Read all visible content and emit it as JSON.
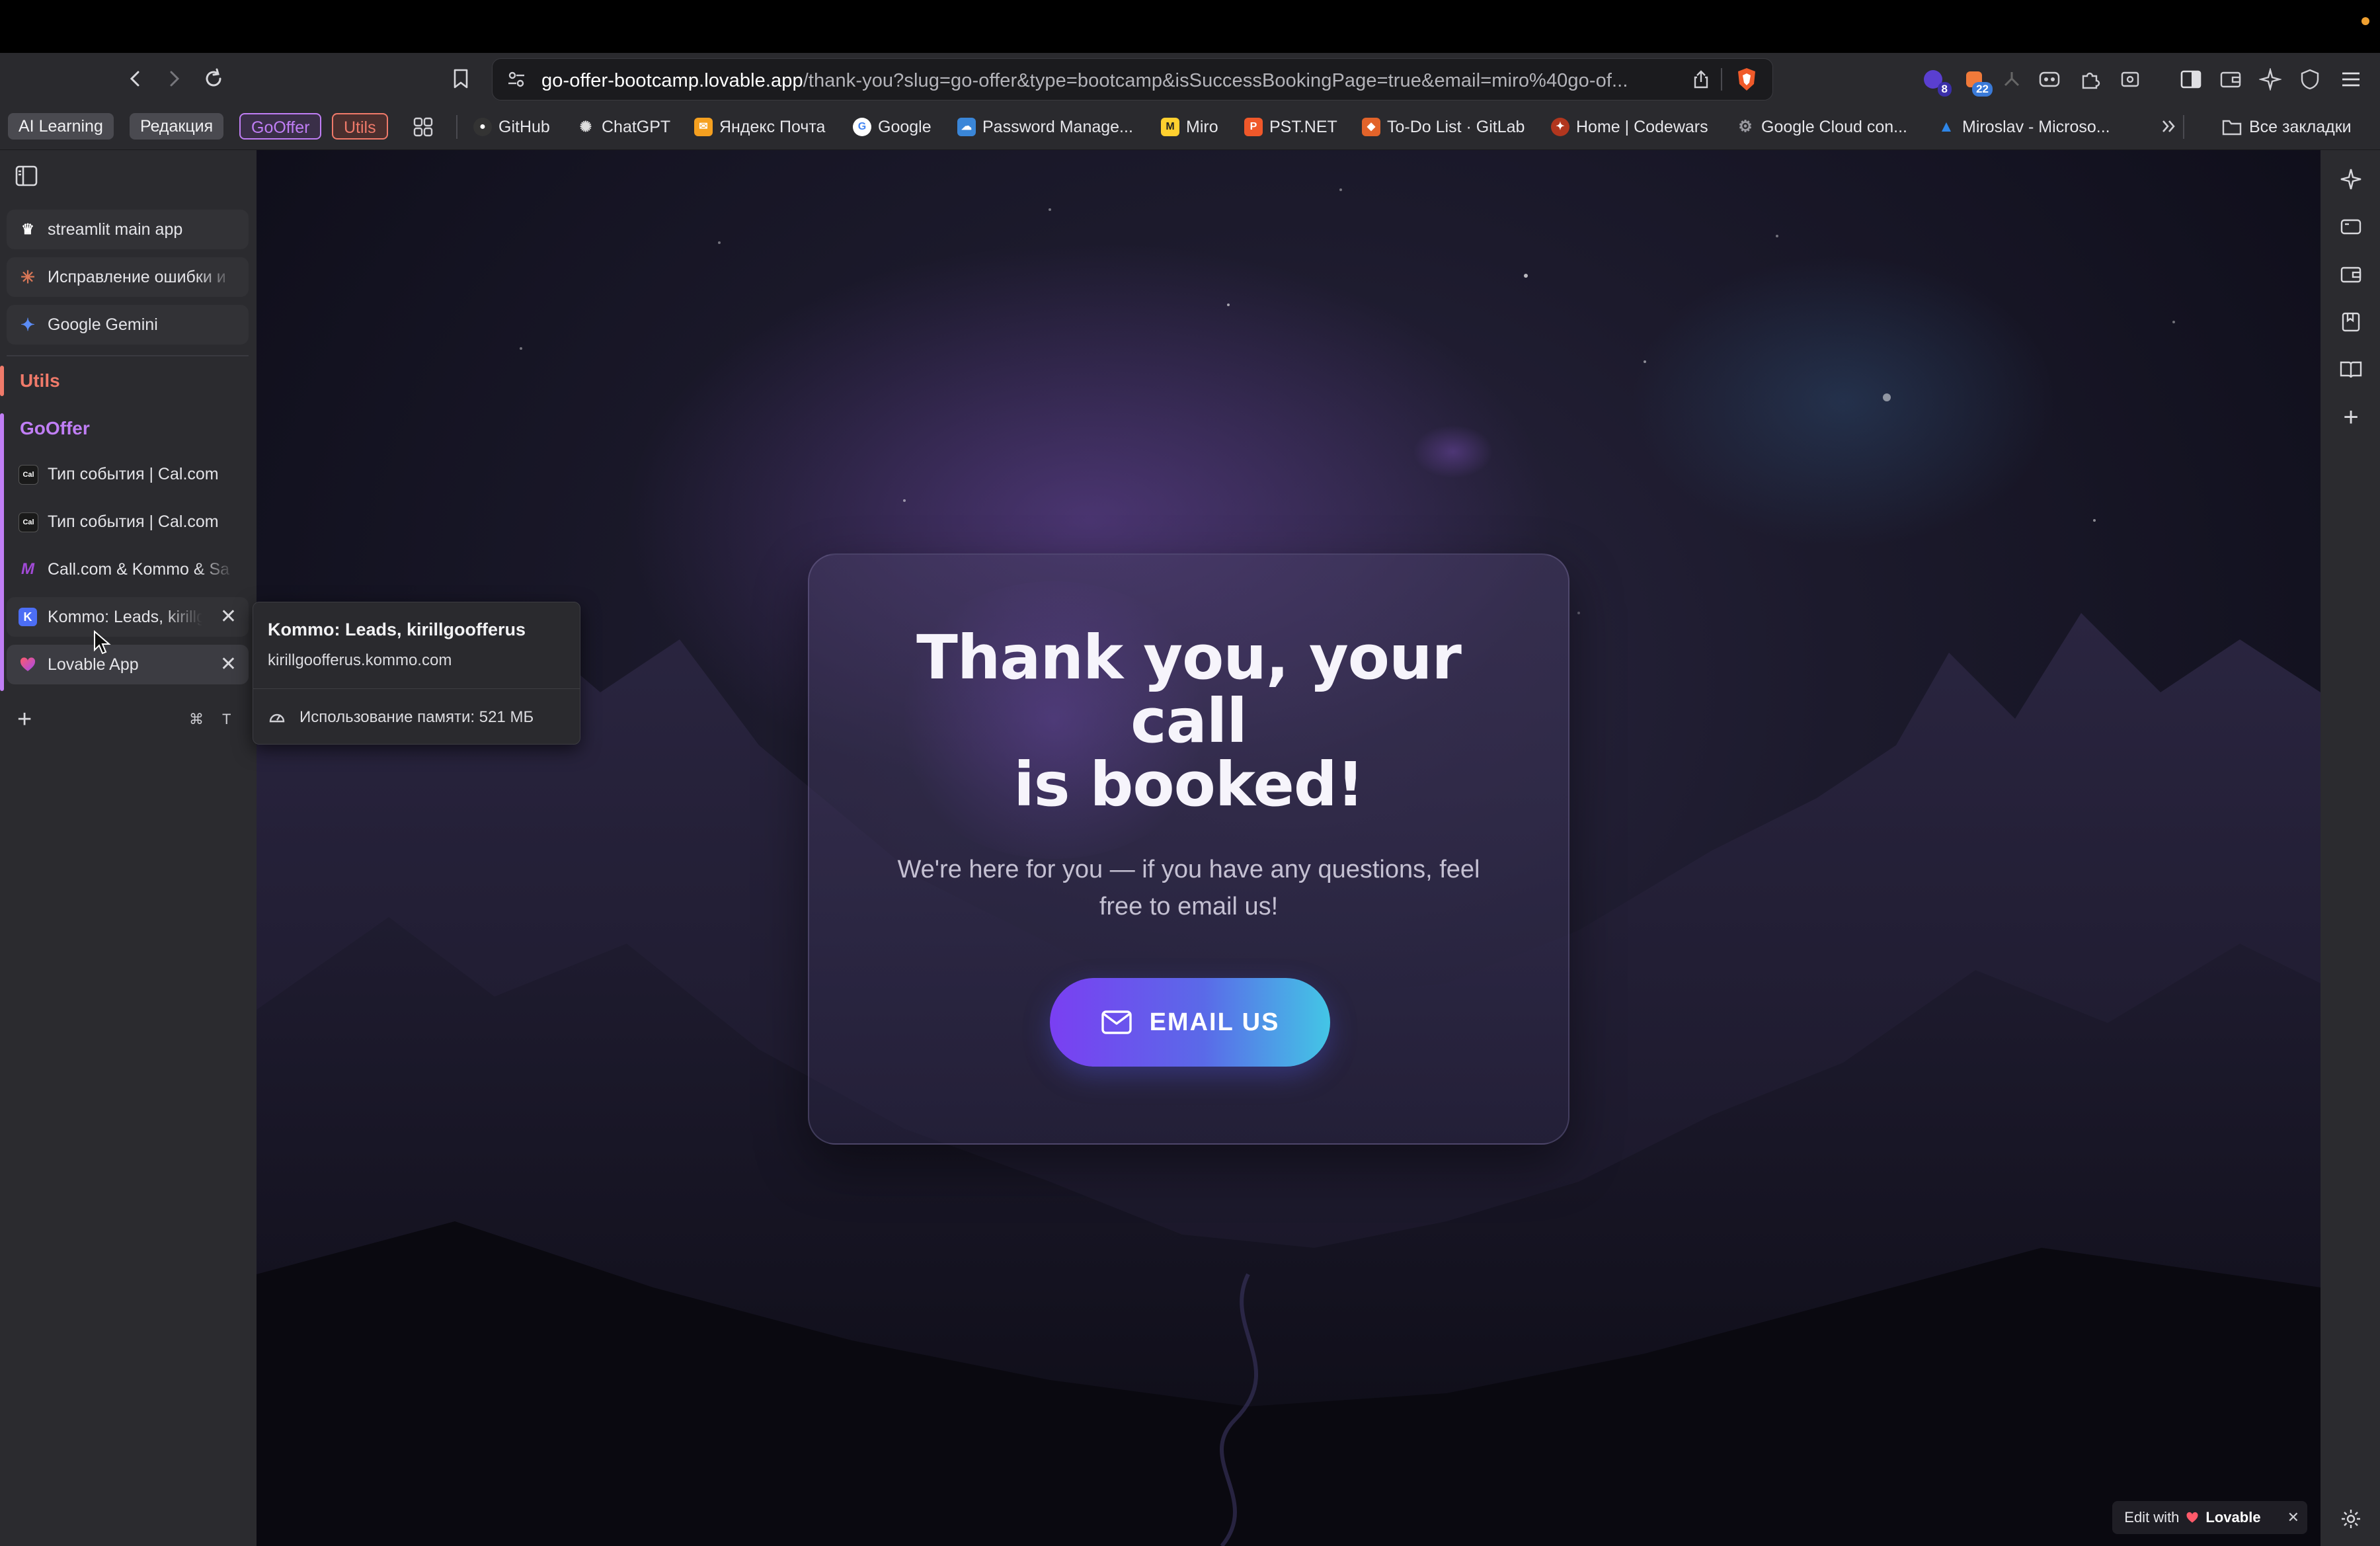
{
  "browser": {
    "url_host": "go-offer-bootcamp.lovable.app",
    "url_path": "/thank-you?slug=go-offer&type=bootcamp&isSuccessBookingPage=true&email=miro%40go-of...",
    "extension_badges": [
      "8",
      "22"
    ]
  },
  "bookmarks_bar": {
    "tab_groups": [
      {
        "label": "AI Learning",
        "color": "#4a4a50"
      },
      {
        "label": "Редакция",
        "color": "#4a4a50"
      },
      {
        "label": "GoOffer",
        "color": "#c07ef5"
      },
      {
        "label": "Utils",
        "color": "#f07a6a"
      }
    ],
    "items": [
      {
        "label": "GitHub",
        "icon": "github-icon"
      },
      {
        "label": "ChatGPT",
        "icon": "chatgpt-icon"
      },
      {
        "label": "Яндекс Почта",
        "icon": "mail-icon"
      },
      {
        "label": "Google",
        "icon": "google-icon"
      },
      {
        "label": "Password Manage...",
        "icon": "cloud-icon"
      },
      {
        "label": "Miro",
        "icon": "miro-icon"
      },
      {
        "label": "PST.NET",
        "icon": "pst-icon"
      },
      {
        "label": "To-Do List · GitLab",
        "icon": "gitlab-icon"
      },
      {
        "label": "Home | Codewars",
        "icon": "codewars-icon"
      },
      {
        "label": "Google Cloud con...",
        "icon": "gear-icon"
      },
      {
        "label": "Miroslav - Microso...",
        "icon": "azure-icon"
      }
    ],
    "all_bookmarks": "Все закладки"
  },
  "sidebar": {
    "pinned": [
      {
        "label": "streamlit main app",
        "icon": "streamlit-icon"
      },
      {
        "label": "Исправление ошибки и",
        "icon": "claude-icon"
      },
      {
        "label": "Google Gemini",
        "icon": "gemini-icon"
      }
    ],
    "groups": [
      {
        "label": "Utils",
        "color": "#f07a6a"
      },
      {
        "label": "GoOffer",
        "color": "#c07ef5"
      }
    ],
    "tabs": [
      {
        "label": "Тип события | Cal.com",
        "icon": "cal-icon",
        "icon_text": "Cal"
      },
      {
        "label": "Тип события | Cal.com",
        "icon": "cal-icon",
        "icon_text": "Cal"
      },
      {
        "label": "Call.com & Kommo & Sa",
        "icon": "make-icon",
        "icon_text": "M"
      },
      {
        "label": "Kommo: Leads, kirillg",
        "icon": "kommo-icon",
        "icon_text": "K"
      },
      {
        "label": "Lovable App",
        "icon": "lovable-icon",
        "icon_text": ""
      }
    ],
    "new_tab_shortcut": [
      "⌘",
      "T"
    ]
  },
  "tooltip": {
    "title": "Kommo: Leads, kirillgoofferus",
    "domain": "kirillgoofferus.kommo.com",
    "memory": "Использование памяти: 521 МБ"
  },
  "page": {
    "headline_lines": [
      "Thank you, your",
      "call",
      "is booked!"
    ],
    "subtext": "We're here for you — if you have any questions, feel free to email us!",
    "email_button": "EMAIL US",
    "lovable_badge": {
      "prefix": "Edit with",
      "brand": "Lovable"
    }
  },
  "colors": {
    "accent_purple": "#7a3ff2",
    "accent_cyan": "#43c6e6",
    "utils_group": "#f07a6a",
    "gooffer_group": "#c07ef5"
  }
}
